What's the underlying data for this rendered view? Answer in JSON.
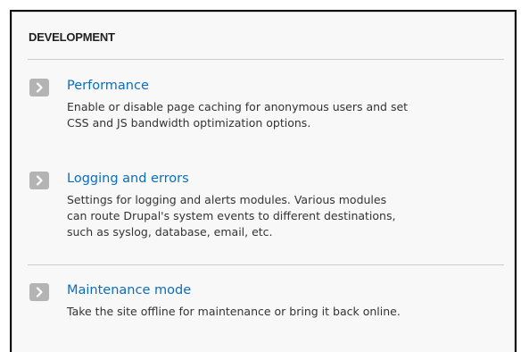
{
  "panel": {
    "title": "DEVELOPMENT"
  },
  "items": [
    {
      "label": "Performance",
      "icon": "chevron-right-icon",
      "description_lines": [
        "Enable or disable page caching for anonymous users and set",
        "CSS and JS bandwidth optimization options."
      ]
    },
    {
      "label": "Logging and errors",
      "icon": "chevron-right-icon",
      "description_lines": [
        "Settings for logging and alerts modules. Various modules",
        "can route Drupal's system events to different destinations,",
        "such as syslog, database, email, etc."
      ]
    },
    {
      "label": "Maintenance mode",
      "icon": "chevron-right-icon",
      "description_lines": [
        "Take the site offline for maintenance or bring it back online."
      ]
    }
  ],
  "colors": {
    "link": "#0a6dbf",
    "text": "#333333",
    "panel_bg": "#f8f8f8",
    "chevron_bg": "#b4b4b4",
    "divider": "#cccccc"
  }
}
